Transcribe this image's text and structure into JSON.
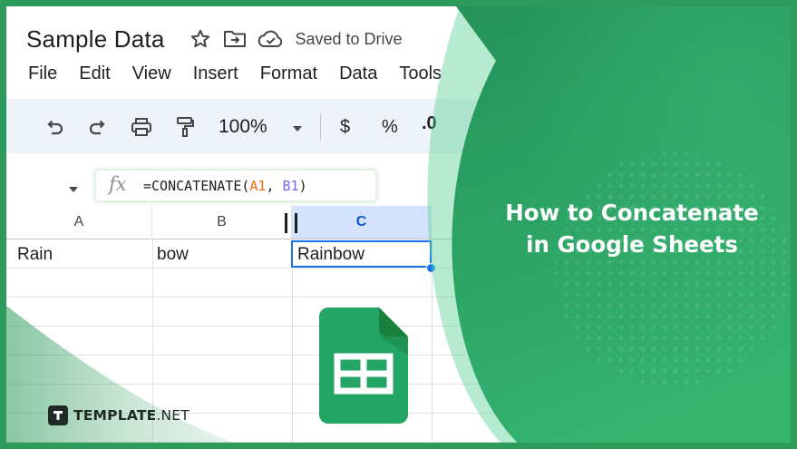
{
  "document": {
    "title": "Sample Data",
    "save_status": "Saved to Drive"
  },
  "menu": [
    "File",
    "Edit",
    "View",
    "Insert",
    "Format",
    "Data",
    "Tools"
  ],
  "toolbar": {
    "zoom": "100%",
    "currency": "$",
    "percent": "%",
    "decimal": ".0"
  },
  "formula_bar": {
    "fx_label": "fx",
    "formula_prefix": "=CONCATENATE(",
    "ref_a": "A1",
    "separator": ", ",
    "ref_b": "B1",
    "formula_suffix": ")"
  },
  "grid": {
    "columns": [
      "A",
      "B",
      "C"
    ],
    "row1": [
      "Rain",
      "bow",
      "Rainbow"
    ]
  },
  "article": {
    "title_line1": "How to Concatenate",
    "title_line2": "in Google Sheets"
  },
  "brand": {
    "name_bold": "TEMPLATE",
    "name_regular": ".NET"
  },
  "colors": {
    "brand_green": "#2b9a5a",
    "sheets_green": "#23a566",
    "selection_blue": "#1a73e8"
  }
}
